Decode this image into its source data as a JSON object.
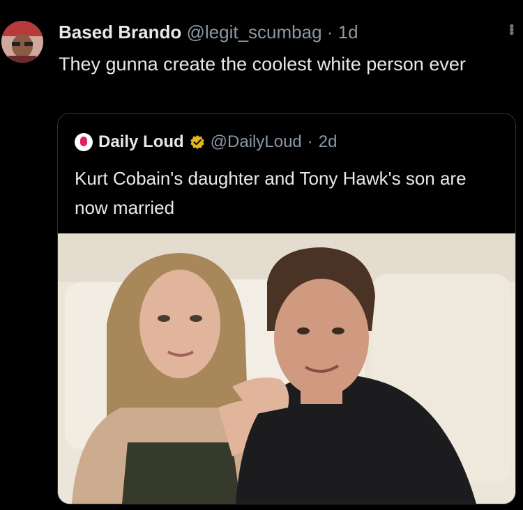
{
  "tweet": {
    "author_name": "Based Brando",
    "author_handle": "@legit_scumbag",
    "separator": "·",
    "time": "1d",
    "text": "They gunna create the coolest white person ever"
  },
  "quoted_tweet": {
    "author_name": "Daily Loud",
    "author_handle": "@DailyLoud",
    "separator": "·",
    "time": "2d",
    "text": "Kurt Cobain's daughter and Tony Hawk's son are now married"
  },
  "icons": {
    "more": "more-options-icon",
    "verified": "verified-badge-icon"
  },
  "colors": {
    "background": "#000000",
    "text": "#e7e9ea",
    "secondary": "#8b98a5",
    "verified_gold": "#e2b719"
  }
}
